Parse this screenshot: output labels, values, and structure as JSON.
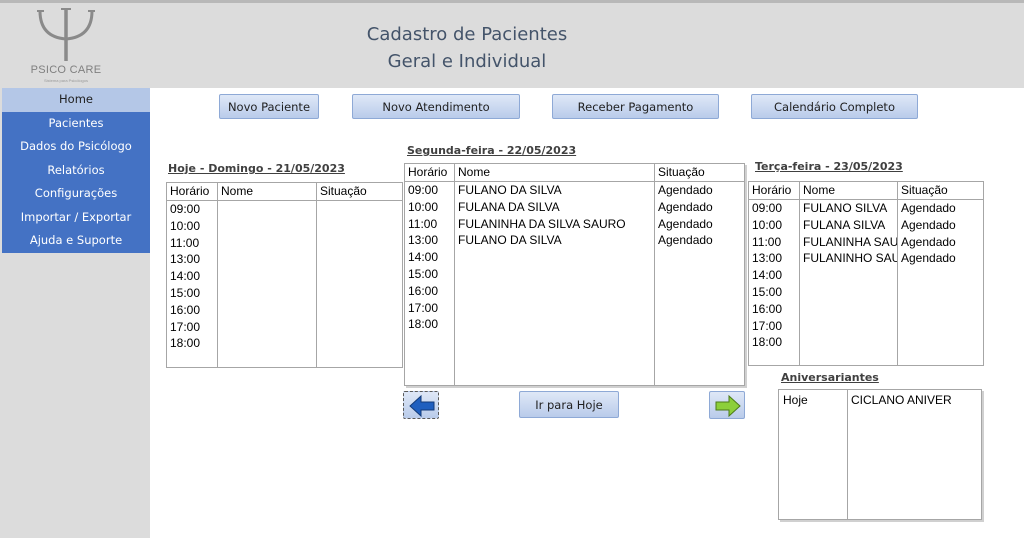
{
  "brand": {
    "name": "PSICO CARE",
    "tagline": "Sistema para Psicólogos",
    "icon": "psi-icon"
  },
  "title": {
    "line1": "Cadastro de Pacientes",
    "line2": "Geral e Individual"
  },
  "nav": {
    "home": "Home",
    "pacientes": "Pacientes",
    "dados": "Dados do Psicólogo",
    "relatorios": "Relatórios",
    "config": "Configurações",
    "importar": "Importar / Exportar",
    "ajuda": "Ajuda e Suporte"
  },
  "toolbar": {
    "novo_paciente": "Novo Paciente",
    "novo_atendimento": "Novo Atendimento",
    "receber_pagamento": "Receber Pagamento",
    "calendario": "Calendário Completo"
  },
  "columns": {
    "horario": "Horário",
    "nome": "Nome",
    "situacao": "Situação"
  },
  "today": {
    "label": "Hoje - Domingo -  21/05/2023",
    "rows": [
      {
        "hora": "09:00",
        "nome": "",
        "situacao": ""
      },
      {
        "hora": "10:00",
        "nome": "",
        "situacao": ""
      },
      {
        "hora": "11:00",
        "nome": "",
        "situacao": ""
      },
      {
        "hora": "13:00",
        "nome": "",
        "situacao": ""
      },
      {
        "hora": "14:00",
        "nome": "",
        "situacao": ""
      },
      {
        "hora": "15:00",
        "nome": "",
        "situacao": ""
      },
      {
        "hora": "16:00",
        "nome": "",
        "situacao": ""
      },
      {
        "hora": "17:00",
        "nome": "",
        "situacao": ""
      },
      {
        "hora": "18:00",
        "nome": "",
        "situacao": ""
      }
    ]
  },
  "monday": {
    "label": "Segunda-feira -  22/05/2023",
    "rows": [
      {
        "hora": "09:00",
        "nome": "FULANO DA SILVA",
        "situacao": "Agendado"
      },
      {
        "hora": "10:00",
        "nome": "FULANA DA SILVA",
        "situacao": "Agendado"
      },
      {
        "hora": "11:00",
        "nome": "FULANINHA DA SILVA SAURO",
        "situacao": "Agendado"
      },
      {
        "hora": "13:00",
        "nome": "FULANO DA SILVA",
        "situacao": "Agendado"
      },
      {
        "hora": "14:00",
        "nome": "",
        "situacao": ""
      },
      {
        "hora": "15:00",
        "nome": "",
        "situacao": ""
      },
      {
        "hora": "16:00",
        "nome": "",
        "situacao": ""
      },
      {
        "hora": "17:00",
        "nome": "",
        "situacao": ""
      },
      {
        "hora": "18:00",
        "nome": "",
        "situacao": ""
      }
    ]
  },
  "tuesday": {
    "label": "Terça-feira -  23/05/2023",
    "rows": [
      {
        "hora": "09:00",
        "nome": "FULANO SILVA",
        "situacao": "Agendado"
      },
      {
        "hora": "10:00",
        "nome": "FULANA SILVA",
        "situacao": "Agendado"
      },
      {
        "hora": "11:00",
        "nome": "FULANINHA SAURO",
        "situacao": "Agendado"
      },
      {
        "hora": "13:00",
        "nome": "FULANINHO SAURO",
        "situacao": "Agendado"
      },
      {
        "hora": "14:00",
        "nome": "",
        "situacao": ""
      },
      {
        "hora": "15:00",
        "nome": "",
        "situacao": ""
      },
      {
        "hora": "16:00",
        "nome": "",
        "situacao": ""
      },
      {
        "hora": "17:00",
        "nome": "",
        "situacao": ""
      },
      {
        "hora": "18:00",
        "nome": "",
        "situacao": ""
      }
    ]
  },
  "nav_buttons": {
    "prev_icon": "arrow-left-icon",
    "next_icon": "arrow-right-icon",
    "today": "Ir para Hoje"
  },
  "birthdays": {
    "label": "Aniversariantes",
    "rows": [
      {
        "quando": "Hoje",
        "nome": "CICLANO ANIVER"
      }
    ]
  },
  "colors": {
    "header_bg": "#dcdcdc",
    "nav_bg": "#4472c4",
    "nav_active_bg": "#b4c7e7",
    "title_text": "#44546a",
    "arrow_left": "#1f5fbf",
    "arrow_right": "#8ccf3a"
  }
}
